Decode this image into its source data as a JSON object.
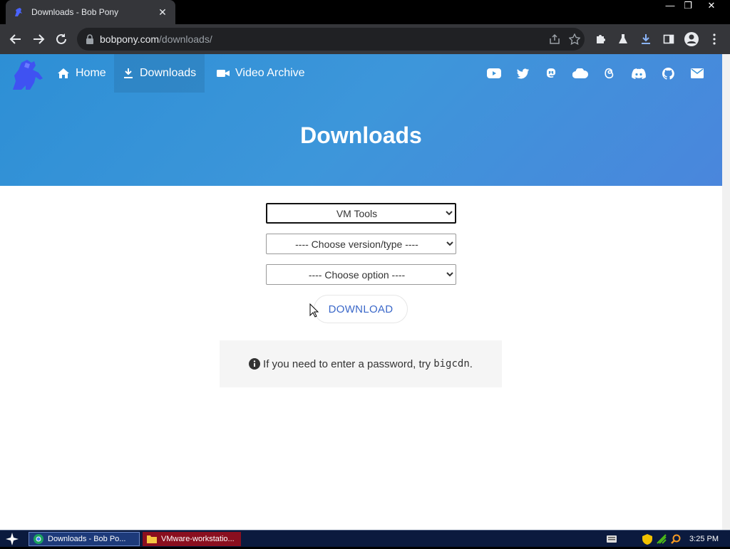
{
  "browser": {
    "tab_title": "Downloads - Bob Pony",
    "tab_close": "✕",
    "url_host": "bobpony.com",
    "url_path": "/downloads/",
    "window_controls": {
      "minimize": "—",
      "restore": "❐",
      "close": "✕"
    }
  },
  "site": {
    "nav": {
      "home": "Home",
      "downloads": "Downloads",
      "video_archive": "Video Archive"
    },
    "social_icons": [
      "youtube-icon",
      "twitter-icon",
      "mastodon-icon",
      "cloud-icon",
      "threads-icon",
      "discord-icon",
      "github-icon",
      "email-icon"
    ],
    "hero_title": "Downloads",
    "selects": {
      "category": "VM Tools",
      "version": "---- Choose version/type ----",
      "option": "---- Choose option ----"
    },
    "download_button": "DOWNLOAD",
    "notice": {
      "text": "If you need to enter a password, try",
      "password": "bigcdn",
      "suffix": "."
    },
    "colors": {
      "hero_start": "#2d8fd5",
      "hero_end": "#4a86dc",
      "button_text": "#3b68c9"
    }
  },
  "taskbar": {
    "tasks": [
      {
        "label": "Downloads - Bob Po..."
      },
      {
        "label": "VMware-workstatio..."
      }
    ],
    "clock": "3:25 PM"
  }
}
